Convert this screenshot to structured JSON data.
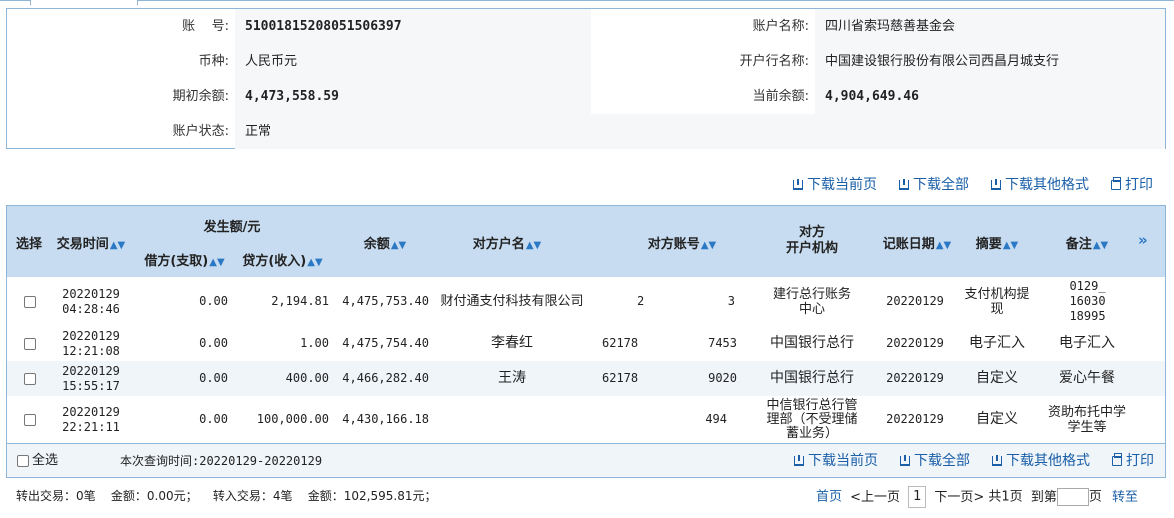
{
  "account": {
    "account_no_label": "账    号:",
    "account_no": "51001815208051506397",
    "account_name_label": "账户名称:",
    "account_name": "四川省索玛慈善基金会",
    "currency_label": "币种:",
    "currency": "人民币元",
    "bank_label": "开户行名称:",
    "bank": "中国建设银行股份有限公司西昌月城支行",
    "opening_balance_label": "期初余额:",
    "opening_balance": "4,473,558.59",
    "current_balance_label": "当前余额:",
    "current_balance": "4,904,649.46",
    "status_label": "账户状态:",
    "status": "正常"
  },
  "toolbar": {
    "download_current": "下载当前页",
    "download_all": "下载全部",
    "download_other": "下载其他格式",
    "print": "打印"
  },
  "table": {
    "headers": {
      "select": "选择",
      "time": "交易时间",
      "amount_group": "发生额/元",
      "debit": "借方(支取)",
      "credit": "贷方(收入)",
      "balance": "余额",
      "counterparty_name": "对方户名",
      "counterparty_account": "对方账号",
      "counterparty_bank_l1": "对方",
      "counterparty_bank_l2": "开户机构",
      "post_date": "记账日期",
      "summary": "摘要",
      "remark": "备注",
      "more": "»"
    },
    "sort_glyph": "▲▼",
    "rows": [
      {
        "date": "20220129",
        "time": "04:28:46",
        "debit": "0.00",
        "credit": "2,194.81",
        "balance": "4,475,753.40",
        "name": "财付通支付科技有限公司",
        "acct_a": "2",
        "acct_b": "3",
        "bank": "建行总行账务中心",
        "post_date": "20220129",
        "summary": "支付机构提现",
        "remark": "0129_\n16030\n18995"
      },
      {
        "date": "20220129",
        "time": "12:21:08",
        "debit": "0.00",
        "credit": "1.00",
        "balance": "4,475,754.40",
        "name": "李春红",
        "acct_a": "62178",
        "acct_b": "7453",
        "bank": "中国银行总行",
        "post_date": "20220129",
        "summary": "电子汇入",
        "remark": "电子汇入"
      },
      {
        "date": "20220129",
        "time": "15:55:17",
        "debit": "0.00",
        "credit": "400.00",
        "balance": "4,466,282.40",
        "name": "王涛",
        "acct_a": "62178",
        "acct_b": "9020",
        "bank": "中国银行总行",
        "post_date": "20220129",
        "summary": "自定义",
        "remark": "爱心午餐"
      },
      {
        "date": "20220129",
        "time": "22:21:11",
        "debit": "0.00",
        "credit": "100,000.00",
        "balance": "4,430,166.18",
        "name": "",
        "acct_a": "",
        "acct_b": "494",
        "bank": "中信银行总行管理部（不受理储蓄业务）",
        "post_date": "20220129",
        "summary": "自定义",
        "remark": "资助布托中学学生等"
      }
    ]
  },
  "footer": {
    "select_all": "全选",
    "query_time": "本次查询时间:20220129-20220129",
    "summary_text": "转出交易：0笔    金额：0.00元；    转入交易：4笔    金额：102,595.81元；",
    "first": "首页",
    "prev": "<上一页",
    "page": "1",
    "next": "下一页>",
    "total": "共1页",
    "goto": "到第",
    "page_unit": "页",
    "jump": "转至"
  },
  "colors": {
    "header_bg": "#c7dcf0",
    "border": "#8fb5d8",
    "link": "#1a5fa8",
    "row_alt": "#f0f5fa"
  }
}
